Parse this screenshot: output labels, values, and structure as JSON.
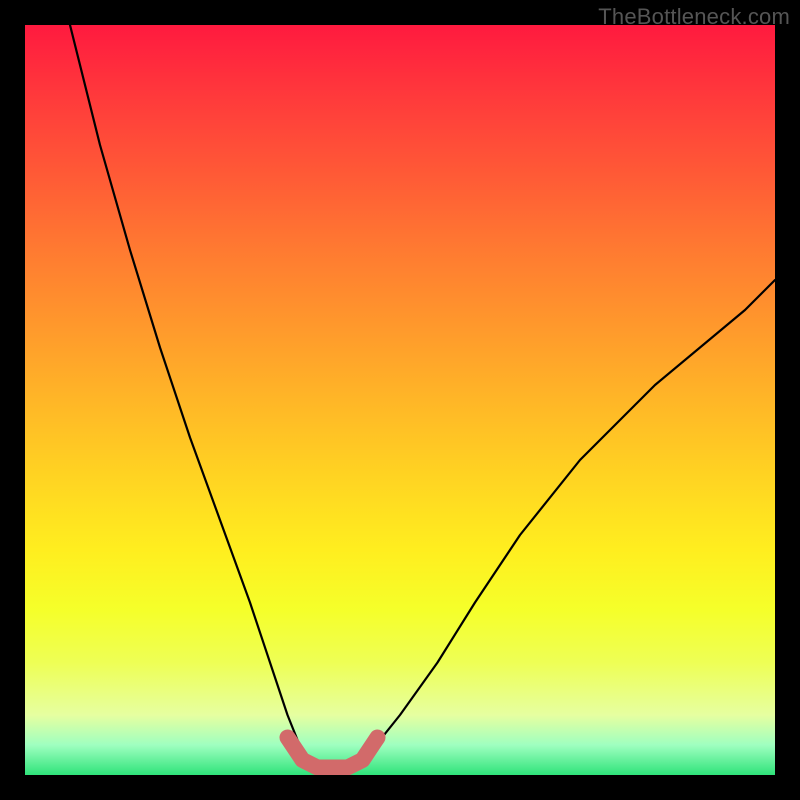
{
  "watermark": "TheBottleneck.com",
  "chart_data": {
    "type": "line",
    "title": "",
    "xlabel": "",
    "ylabel": "",
    "xlim": [
      0,
      100
    ],
    "ylim": [
      0,
      100
    ],
    "series": [
      {
        "name": "bottleneck-curve",
        "x": [
          6,
          10,
          14,
          18,
          22,
          26,
          30,
          33,
          35,
          37,
          40,
          43,
          46,
          50,
          55,
          60,
          66,
          74,
          84,
          96,
          100
        ],
        "y": [
          100,
          84,
          70,
          57,
          45,
          34,
          23,
          14,
          8,
          3,
          1,
          1,
          3,
          8,
          15,
          23,
          32,
          42,
          52,
          62,
          66
        ]
      },
      {
        "name": "bottom-marker",
        "x": [
          35,
          37,
          39,
          41,
          43,
          45,
          47
        ],
        "y": [
          5,
          2,
          1,
          1,
          1,
          2,
          5
        ]
      }
    ],
    "gradient_stops": [
      {
        "pos": 0,
        "color": "#ff1a3f"
      },
      {
        "pos": 10,
        "color": "#ff3b3b"
      },
      {
        "pos": 20,
        "color": "#ff5a36"
      },
      {
        "pos": 30,
        "color": "#ff7a31"
      },
      {
        "pos": 40,
        "color": "#ff982c"
      },
      {
        "pos": 50,
        "color": "#ffb627"
      },
      {
        "pos": 60,
        "color": "#ffd322"
      },
      {
        "pos": 70,
        "color": "#ffee1f"
      },
      {
        "pos": 78,
        "color": "#f5ff2a"
      },
      {
        "pos": 85,
        "color": "#eeff55"
      },
      {
        "pos": 92,
        "color": "#e6ffa0"
      },
      {
        "pos": 96,
        "color": "#9fffc0"
      },
      {
        "pos": 100,
        "color": "#2fe37a"
      }
    ]
  }
}
